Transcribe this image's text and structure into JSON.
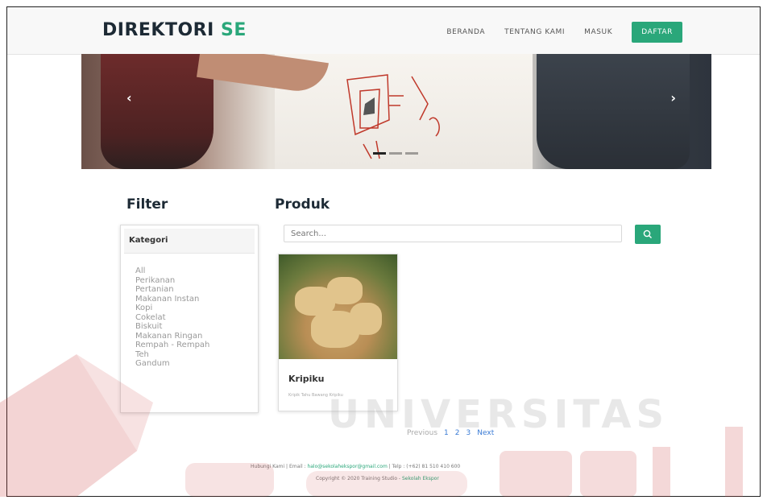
{
  "brand": {
    "main": "DIREKTORI",
    "accent": "SE"
  },
  "nav": {
    "items": [
      "BERANDA",
      "TENTANG KAMI",
      "MASUK"
    ],
    "cta": "DAFTAR"
  },
  "hero": {
    "prev_icon": "chevron-left-icon",
    "next_icon": "chevron-right-icon",
    "slides": 3,
    "active_slide": 1
  },
  "sections": {
    "filter_title": "Filter",
    "produk_title": "Produk"
  },
  "filter": {
    "header": "Kategori",
    "categories": [
      "All",
      "Perikanan",
      "Pertanian",
      "Makanan Instan",
      "Kopi",
      "Cokelat",
      "Biskuit",
      "Makanan Ringan",
      "Rempah - Rempah",
      "Teh",
      "Gandum"
    ]
  },
  "search": {
    "placeholder": "Search...",
    "button_icon": "search-icon"
  },
  "products": [
    {
      "name": "Kripiku",
      "desc": "Kripik Tahu Bawang Kripiku"
    }
  ],
  "pagination": {
    "previous": "Previous",
    "pages": [
      "1",
      "2",
      "3"
    ],
    "next": "Next"
  },
  "footer": {
    "line1_prefix": "Hubungi Kami | Email : ",
    "email": "halo@sekolahekspor@gmail.com",
    "line1_suffix": " | Telp : (+62) 81 510 410 600",
    "line2_prefix": "Copyright © 2020 Training Studio - ",
    "line2_link": "Sekolah Ekspor"
  },
  "watermark": {
    "text": "UNIVERSITAS"
  },
  "colors": {
    "accent": "#2aa77a",
    "brand_dark": "#1d2a35",
    "link": "#3a7bd5"
  }
}
